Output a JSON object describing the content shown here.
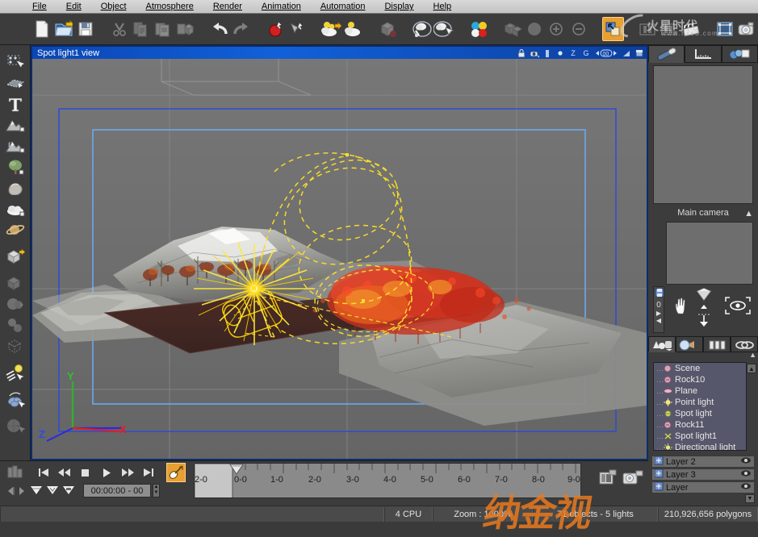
{
  "app": {
    "viewport_title": "Spot light1 view"
  },
  "menubar": {
    "items": [
      {
        "label": "File",
        "accel": "F"
      },
      {
        "label": "Edit",
        "accel": "E"
      },
      {
        "label": "Object",
        "accel": "O"
      },
      {
        "label": "Atmosphere",
        "accel": "A"
      },
      {
        "label": "Render",
        "accel": "R"
      },
      {
        "label": "Animation",
        "accel": "A"
      },
      {
        "label": "Automation",
        "accel": "A"
      },
      {
        "label": "Display",
        "accel": "D"
      },
      {
        "label": "Help",
        "accel": "H"
      }
    ]
  },
  "toolbar": {
    "items": [
      {
        "name": "new-file-icon",
        "label": "New"
      },
      {
        "name": "open-file-icon",
        "label": "Open"
      },
      {
        "name": "save-file-icon",
        "label": "Save"
      },
      {
        "name": "sep"
      },
      {
        "name": "cut-icon",
        "label": "Cut"
      },
      {
        "name": "copy-icon",
        "label": "Copy"
      },
      {
        "name": "paste-icon",
        "label": "Paste"
      },
      {
        "name": "duplicate-icon",
        "label": "Duplicate"
      },
      {
        "name": "sep"
      },
      {
        "name": "undo-icon",
        "label": "Undo"
      },
      {
        "name": "redo-icon",
        "label": "Redo"
      },
      {
        "name": "sep"
      },
      {
        "name": "record-icon",
        "label": "Record"
      },
      {
        "name": "pick-icon",
        "label": "Pick"
      },
      {
        "name": "sep"
      },
      {
        "name": "load-atmosphere-icon",
        "label": "Load atmosphere"
      },
      {
        "name": "save-atmosphere-icon",
        "label": "Save atmosphere"
      },
      {
        "name": "sep"
      },
      {
        "name": "object-properties-icon",
        "label": "Object properties"
      },
      {
        "name": "sep"
      },
      {
        "name": "load-material-icon",
        "label": "Load material"
      },
      {
        "name": "edit-material-icon",
        "label": "Edit material"
      },
      {
        "name": "sep"
      },
      {
        "name": "color-picker-icon",
        "label": "Colors"
      },
      {
        "name": "sep"
      },
      {
        "name": "boolean-icon",
        "label": "Boolean"
      },
      {
        "name": "sphere-primitive-icon",
        "label": "Sphere"
      },
      {
        "name": "add-icon",
        "label": "Add"
      },
      {
        "name": "subtract-icon",
        "label": "Subtract"
      },
      {
        "name": "sep"
      },
      {
        "name": "render-preview-icon",
        "label": "Render preview",
        "selected": true
      },
      {
        "name": "sep"
      },
      {
        "name": "film-strip-icon",
        "label": "Film strip"
      },
      {
        "name": "film-strip2-icon",
        "label": "Storyboard"
      },
      {
        "name": "clapperboard-icon",
        "label": "Animation render"
      },
      {
        "name": "sep"
      },
      {
        "name": "render-area-icon",
        "label": "Render area"
      },
      {
        "name": "camera-render-icon",
        "label": "Render camera"
      }
    ]
  },
  "watermark": {
    "text": "火星时代",
    "url": "www.hxsd.com",
    "bottom_text": "纳金视"
  },
  "left_toolbar": {
    "items": [
      {
        "name": "select-tool-icon",
        "label": "Select"
      },
      {
        "name": "ground-plane-icon",
        "label": "Infinite plane"
      },
      {
        "name": "text-tool-icon",
        "label": "Text"
      },
      {
        "name": "terrain-icon",
        "label": "Terrain"
      },
      {
        "name": "procedural-terrain-icon",
        "label": "Procedural terrain"
      },
      {
        "name": "tree-icon",
        "label": "Plant"
      },
      {
        "name": "rock-icon",
        "label": "Rock"
      },
      {
        "name": "cloud-icon",
        "label": "Cloud / MetaCloud"
      },
      {
        "name": "planet-icon",
        "label": "Planet"
      },
      {
        "name": "sep"
      },
      {
        "name": "primitive-cube-icon",
        "label": "Primitives"
      },
      {
        "name": "sep"
      },
      {
        "name": "boolean-object-icon",
        "label": "Boolean object"
      },
      {
        "name": "metablob-icon",
        "label": "MetaBlob"
      },
      {
        "name": "group-icon",
        "label": "Group"
      },
      {
        "name": "import-object-icon",
        "label": "Import object"
      },
      {
        "name": "sep"
      },
      {
        "name": "light-tool-icon",
        "label": "Light"
      },
      {
        "name": "sep"
      },
      {
        "name": "ecosystem-icon",
        "label": "EcoSystem painter"
      },
      {
        "name": "sep"
      },
      {
        "name": "sphere-tool-icon",
        "label": "Sphere"
      }
    ]
  },
  "viewport": {
    "controls": [
      {
        "name": "lock-view-icon",
        "label": "Lock view"
      },
      {
        "name": "camera-view-icon",
        "label": "Camera"
      },
      {
        "name": "split-view-icon",
        "label": "Split"
      },
      {
        "name": "point-display-icon",
        "label": "Point"
      },
      {
        "name": "axis-z-label",
        "label": "Z"
      },
      {
        "name": "grid-icon",
        "label": "G"
      },
      {
        "name": "zoom-stepper",
        "label": "00"
      },
      {
        "name": "shade-icon",
        "label": "Shading"
      },
      {
        "name": "maximize-view-icon",
        "label": "Maximize"
      }
    ],
    "axis_gizmo": {
      "x": "X",
      "y": "Y",
      "z": "Z"
    }
  },
  "right_panel": {
    "tabs": [
      {
        "name": "world-browser-tab",
        "label": "World browser",
        "active": true
      },
      {
        "name": "numeric-tab",
        "label": "Numerics"
      },
      {
        "name": "materials-tab",
        "label": "Materials"
      }
    ],
    "camera_panel": {
      "title": "Main camera",
      "collapse": "▲",
      "controls": [
        {
          "name": "pan-hand-icon",
          "label": "Pan"
        },
        {
          "name": "orbit-diamond-icon",
          "label": "Orbit"
        },
        {
          "name": "move-updown-icon",
          "label": "Move up/down"
        },
        {
          "name": "look-eye-icon",
          "label": "Look at"
        },
        {
          "name": "save-camera-icon",
          "label": "Save camera"
        },
        {
          "name": "camera-index",
          "label": "0"
        },
        {
          "name": "next-camera-icon",
          "label": "▶"
        },
        {
          "name": "prev-camera-icon",
          "label": "◀"
        }
      ]
    },
    "browser_tabs": [
      {
        "name": "objects-browser-tab",
        "label": "Objects",
        "active": true
      },
      {
        "name": "atmosphere-browser-tab",
        "label": "Atmosphere"
      },
      {
        "name": "layers-browser-tab",
        "label": "Layers"
      },
      {
        "name": "links-browser-tab",
        "label": "Links"
      }
    ],
    "object_tree": [
      {
        "name": "tree-item-scene",
        "label": "Scene",
        "icon": "rock-icon",
        "partial": true
      },
      {
        "name": "tree-item-rock10",
        "label": "Rock10",
        "icon": "rock-icon"
      },
      {
        "name": "tree-item-plane",
        "label": "Plane",
        "icon": "plane-icon"
      },
      {
        "name": "tree-item-point-light",
        "label": "Point light",
        "icon": "point-light-icon"
      },
      {
        "name": "tree-item-spot-light",
        "label": "Spot light",
        "icon": "spot-light-icon"
      },
      {
        "name": "tree-item-rock11",
        "label": "Rock11",
        "icon": "rock-icon"
      },
      {
        "name": "tree-item-spot-light1",
        "label": "Spot light1",
        "icon": "spot-light-icon"
      },
      {
        "name": "tree-item-directional-light",
        "label": "Directional light",
        "icon": "sun-icon"
      }
    ],
    "layers": [
      {
        "name": "layer-row-2",
        "label": "Layer 2",
        "visible": true
      },
      {
        "name": "layer-row-3",
        "label": "Layer 3",
        "visible": true
      },
      {
        "name": "layer-row-4",
        "label": "Layer",
        "visible": true
      }
    ]
  },
  "bottom": {
    "transport": [
      {
        "name": "go-to-start-button",
        "label": "⏮"
      },
      {
        "name": "rewind-button",
        "label": "⏪"
      },
      {
        "name": "stop-button",
        "label": "■"
      },
      {
        "name": "play-button",
        "label": "▶"
      },
      {
        "name": "fast-forward-button",
        "label": "⏩"
      },
      {
        "name": "go-to-end-button",
        "label": "⏭"
      }
    ],
    "keyframe_buttons": [
      {
        "name": "prev-keyframe-button",
        "label": "▽"
      },
      {
        "name": "add-keyframe-button",
        "label": "▽"
      },
      {
        "name": "next-keyframe-button",
        "label": "▽"
      }
    ],
    "timecode": "00:00:00 - 00",
    "keyframer_label": "Animation wizard",
    "timeline_labels": [
      "0-0",
      "1-0",
      "2-0",
      "3-0",
      "4-0",
      "5-0",
      "6-0",
      "7-0",
      "8-0",
      "9-0"
    ],
    "right_icons": [
      {
        "name": "render-settings-icon",
        "label": "Render settings"
      },
      {
        "name": "render-movie-icon",
        "label": "Render animation"
      }
    ]
  },
  "statusbar": {
    "cpu": "4 CPU",
    "zoom": "Zoom : 1000%",
    "objects": "71 objects - 5 lights",
    "polygons": "210,926,656 polygons"
  }
}
